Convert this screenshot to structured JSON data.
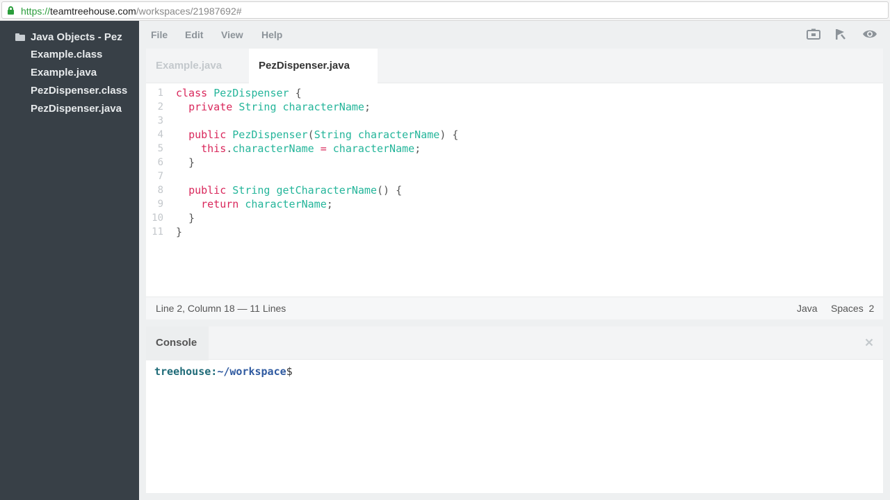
{
  "browser": {
    "url_scheme": "https://",
    "url_host": "teamtreehouse.com",
    "url_path": "/workspaces/21987692#"
  },
  "sidebar": {
    "project_name": "Java Objects - Pez",
    "files": [
      "Example.class",
      "Example.java",
      "PezDispenser.class",
      "PezDispenser.java"
    ]
  },
  "menu": {
    "file": "File",
    "edit": "Edit",
    "view": "View",
    "help": "Help"
  },
  "tabs": [
    {
      "label": "Example.java",
      "active": false
    },
    {
      "label": "PezDispenser.java",
      "active": true
    }
  ],
  "code": {
    "lines": [
      "class PezDispenser {",
      "  private String characterName;",
      "",
      "  public PezDispenser(String characterName) {",
      "    this.characterName = characterName;",
      "  }",
      "",
      "  public String getCharacterName() {",
      "    return characterName;",
      "  }",
      "}"
    ]
  },
  "status": {
    "position": "Line 2, Column 18 — 11 Lines",
    "language": "Java",
    "indent": "Spaces  2"
  },
  "console": {
    "title": "Console",
    "prompt_user": "treehouse:",
    "prompt_path": "~/workspace",
    "prompt_symbol": "$"
  },
  "colors": {
    "sidebar_bg": "#384047",
    "keyword": "#d9275b",
    "type": "#24b59a",
    "secure": "#2a9d3b"
  },
  "icons": [
    "folder-icon",
    "lock-icon",
    "snapshot-icon",
    "share-icon",
    "preview-icon",
    "close-icon"
  ]
}
